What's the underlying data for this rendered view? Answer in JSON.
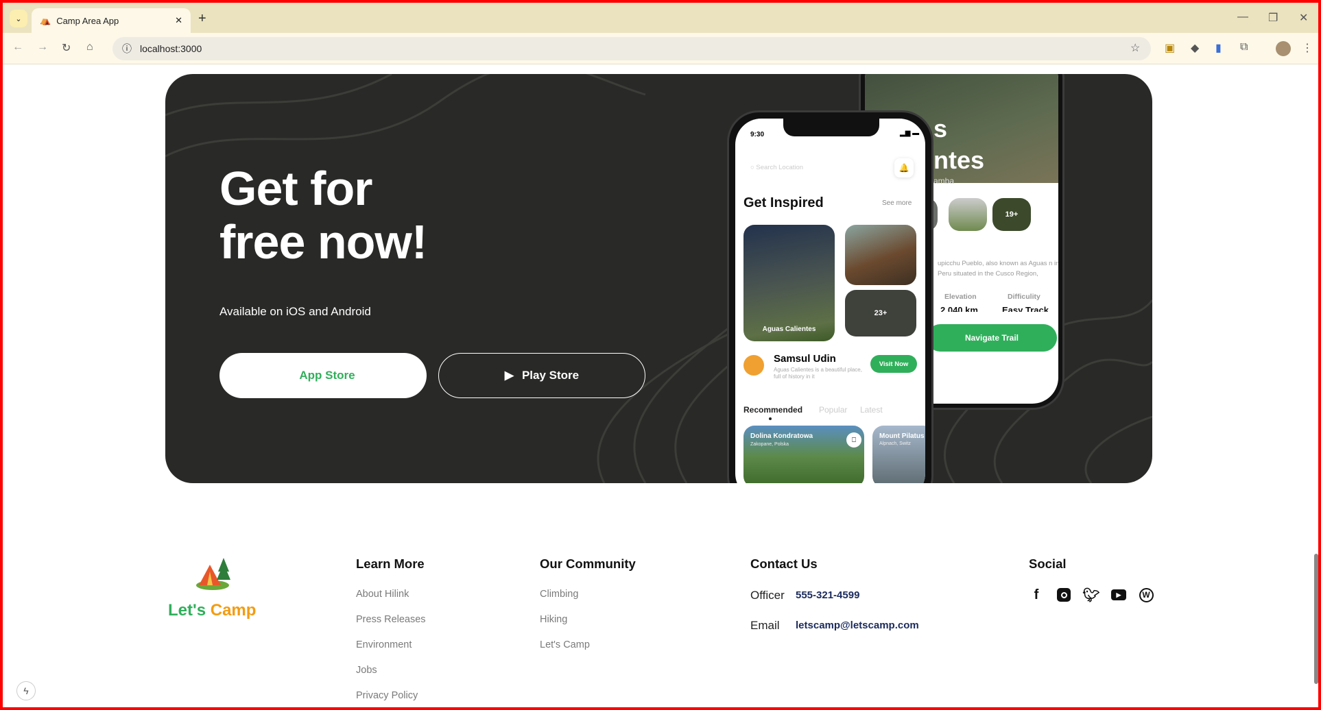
{
  "browser": {
    "tab_title": "Camp Area App",
    "url": "localhost:3000"
  },
  "hero": {
    "title_line1": "Get for",
    "title_line2": "free now!",
    "subtitle": "Available on iOS and Android",
    "app_store": "App Store",
    "play_store": "Play Store"
  },
  "phone_front": {
    "time": "9:30",
    "search_placeholder": "Search Location",
    "section_title": "Get Inspired",
    "see_more": "See more",
    "card_main": "Aguas Calientes",
    "card_count": "23+",
    "person_name": "Samsul Udin",
    "person_desc": "Aguas Calientes is a beautiful place, full of history in it",
    "visit_now": "Visit Now",
    "tabs": [
      "Recommended",
      "Popular",
      "Latest"
    ],
    "rec1_title": "Dolina Kondratowa",
    "rec1_loc": "Zakopane, Polska",
    "rec2_title": "Mount Pilatus",
    "rec2_loc": "Alpnach, Switz"
  },
  "phone_back": {
    "title_part1": "s",
    "title_part2": "ntes",
    "sub": "amba",
    "thumb_count": "19+",
    "desc": "upicchu Pueblo, also known as Aguas n in Peru situated in the Cusco Region,",
    "elevation_label": "Elevation",
    "elevation_value": "2,040 km",
    "difficulty_label": "Difficulity",
    "difficulty_value": "Easy Track",
    "navigate": "Navigate Trail"
  },
  "footer": {
    "brand_part1": "Let's",
    "brand_part2": "Camp",
    "learn_more": {
      "title": "Learn More",
      "links": [
        "About Hilink",
        "Press Releases",
        "Environment",
        "Jobs",
        "Privacy Policy"
      ]
    },
    "community": {
      "title": "Our Community",
      "links": [
        "Climbing",
        "Hiking",
        "Let's Camp"
      ]
    },
    "contact": {
      "title": "Contact Us",
      "officer_label": "Officer",
      "officer_value": "555-321-4599",
      "email_label": "Email",
      "email_value": "letscamp@letscamp.com"
    },
    "social": {
      "title": "Social",
      "icons": [
        "facebook-icon",
        "instagram-icon",
        "twitter-icon",
        "youtube-icon",
        "wordpress-icon"
      ]
    }
  },
  "colors": {
    "green": "#30af5b",
    "orange": "#f39c12",
    "dark": "#292927",
    "navy": "#1a2a5c"
  }
}
